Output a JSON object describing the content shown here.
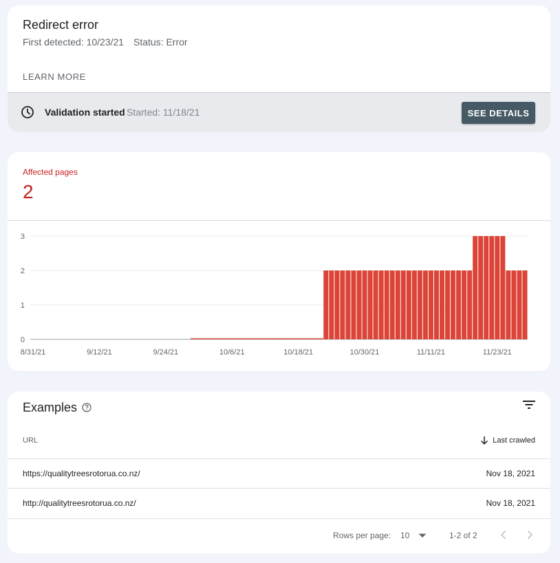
{
  "issue": {
    "title": "Redirect error",
    "first_detected": "First detected: 10/23/21",
    "status": "Status: Error",
    "learn_more": "LEARN MORE"
  },
  "validation": {
    "icon": "clock-icon",
    "title": "Validation started",
    "started": "Started: 11/18/21",
    "button": "SEE DETAILS",
    "button_color": "#455a64"
  },
  "affected": {
    "label": "Affected pages",
    "value": "2",
    "color": "#c5221f"
  },
  "chart_data": {
    "type": "bar",
    "ylim": [
      0,
      3
    ],
    "yticks": [
      "0",
      "1",
      "2",
      "3"
    ],
    "xtick_labels": [
      "8/31/21",
      "9/12/21",
      "9/24/21",
      "10/6/21",
      "10/18/21",
      "10/30/21",
      "11/11/21",
      "11/23/21"
    ],
    "start_date": "8/31/21",
    "bar_color": "#db4437",
    "grid": true,
    "values": [
      0,
      0,
      0,
      0,
      0,
      0,
      0,
      0,
      0,
      0,
      0,
      0,
      0,
      0,
      0,
      0,
      0,
      0,
      0,
      0,
      0,
      0,
      0,
      0,
      0,
      0,
      0,
      0,
      0,
      0,
      0,
      0,
      0,
      0,
      0,
      0,
      0,
      0,
      0,
      0,
      0,
      0,
      0,
      0,
      0,
      0,
      0,
      0,
      0,
      0,
      0,
      0,
      0,
      2,
      2,
      2,
      2,
      2,
      2,
      2,
      2,
      2,
      2,
      2,
      2,
      2,
      2,
      2,
      2,
      2,
      2,
      2,
      2,
      2,
      2,
      2,
      2,
      2,
      2,
      2,
      3,
      3,
      3,
      3,
      3,
      3,
      2,
      2,
      2,
      2
    ]
  },
  "examples": {
    "title": "Examples",
    "help_icon": "help-icon",
    "filter_icon": "filter-icon",
    "columns": {
      "url": "URL",
      "last_crawled": "Last crawled"
    },
    "rows": [
      {
        "url": "https://qualitytreesrotorua.co.nz/",
        "date": "Nov 18, 2021"
      },
      {
        "url": "http://qualitytreesrotorua.co.nz/",
        "date": "Nov 18, 2021"
      }
    ],
    "pagination": {
      "rows_per_page_label": "Rows per page:",
      "rows_per_page": "10",
      "range": "1-2 of 2"
    }
  }
}
